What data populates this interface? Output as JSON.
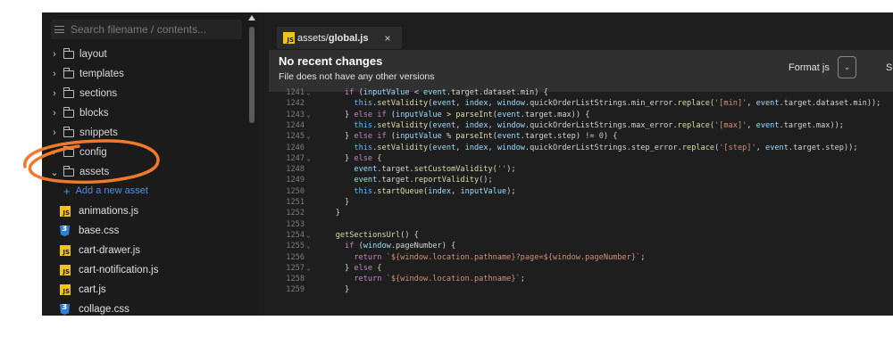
{
  "search": {
    "placeholder": "Search filename / contents..."
  },
  "sidebar": {
    "folders": [
      {
        "label": "layout",
        "expanded": false
      },
      {
        "label": "templates",
        "expanded": false
      },
      {
        "label": "sections",
        "expanded": false
      },
      {
        "label": "blocks",
        "expanded": false
      },
      {
        "label": "snippets",
        "expanded": false
      },
      {
        "label": "config",
        "expanded": false
      },
      {
        "label": "assets",
        "expanded": true
      }
    ],
    "add_asset_label": "Add a new asset",
    "files": [
      {
        "label": "animations.js",
        "type": "js"
      },
      {
        "label": "base.css",
        "type": "css"
      },
      {
        "label": "cart-drawer.js",
        "type": "js"
      },
      {
        "label": "cart-notification.js",
        "type": "js"
      },
      {
        "label": "cart.js",
        "type": "js"
      },
      {
        "label": "collage.css",
        "type": "css"
      }
    ]
  },
  "editor": {
    "tab": {
      "prefix": "assets/",
      "filename": "global.js",
      "badge": "JS",
      "close": "×"
    },
    "info": {
      "title": "No recent changes",
      "subtitle": "File does not have any other versions"
    },
    "format_label": "Format js",
    "save_label": "S",
    "lines": [
      {
        "n": "1241",
        "fold": "⌄",
        "code": "      if (inputValue < event.target.dataset.min) {"
      },
      {
        "n": "1242",
        "fold": "",
        "code": "        this.setValidity(event, index, window.quickOrderListStrings.min_error.replace('[min]', event.target.dataset.min));"
      },
      {
        "n": "1243",
        "fold": "⌄",
        "code": "      } else if (inputValue > parseInt(event.target.max)) {"
      },
      {
        "n": "1244",
        "fold": "",
        "code": "        this.setValidity(event, index, window.quickOrderListStrings.max_error.replace('[max]', event.target.max));"
      },
      {
        "n": "1245",
        "fold": "⌄",
        "code": "      } else if (inputValue % parseInt(event.target.step) != 0) {"
      },
      {
        "n": "1246",
        "fold": "",
        "code": "        this.setValidity(event, index, window.quickOrderListStrings.step_error.replace('[step]', event.target.step));"
      },
      {
        "n": "1247",
        "fold": "⌄",
        "code": "      } else {"
      },
      {
        "n": "1248",
        "fold": "",
        "code": "        event.target.setCustomValidity('');"
      },
      {
        "n": "1249",
        "fold": "",
        "code": "        event.target.reportValidity();"
      },
      {
        "n": "1250",
        "fold": "",
        "code": "        this.startQueue(index, inputValue);"
      },
      {
        "n": "1251",
        "fold": "",
        "code": "      }"
      },
      {
        "n": "1252",
        "fold": "",
        "code": "    }"
      },
      {
        "n": "1253",
        "fold": "",
        "code": ""
      },
      {
        "n": "1254",
        "fold": "⌄",
        "code": "    getSectionsUrl() {"
      },
      {
        "n": "1255",
        "fold": "⌄",
        "code": "      if (window.pageNumber) {"
      },
      {
        "n": "1256",
        "fold": "",
        "code": "        return `${window.location.pathname}?page=${window.pageNumber}`;"
      },
      {
        "n": "1257",
        "fold": "⌄",
        "code": "      } else {"
      },
      {
        "n": "1258",
        "fold": "",
        "code": "        return `${window.location.pathname}`;"
      },
      {
        "n": "1259",
        "fold": "",
        "code": "      }"
      }
    ]
  },
  "colors": {
    "annotation": "#f07a2a",
    "link": "#4f8cf7",
    "js_badge": "#f1c40f",
    "css_badge": "#2d7fd8"
  }
}
